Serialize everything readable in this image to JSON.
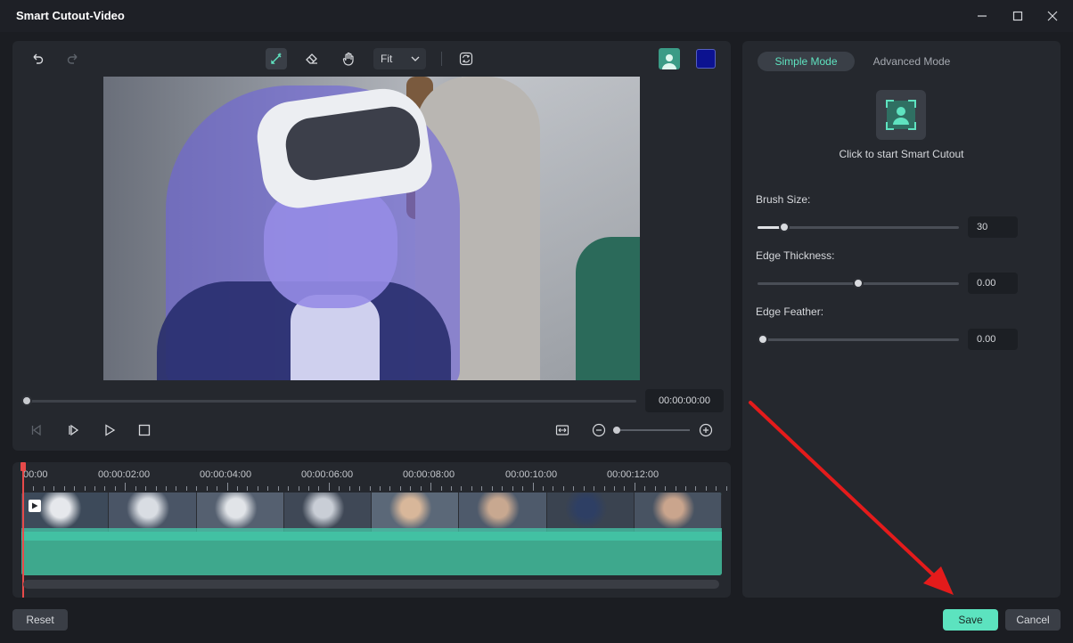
{
  "window": {
    "title": "Smart Cutout-Video"
  },
  "toolbar": {
    "zoom_select_value": "Fit"
  },
  "player": {
    "current_time": "00:00:00:00"
  },
  "timeline": {
    "ticks": [
      "00:00",
      "00:00:02:00",
      "00:00:04:00",
      "00:00:06:00",
      "00:00:08:00",
      "00:00:10:00",
      "00:00:12:00"
    ]
  },
  "right_panel": {
    "tabs": [
      {
        "label": "Simple Mode",
        "active": true
      },
      {
        "label": "Advanced Mode",
        "active": false
      }
    ],
    "cutout_prompt": "Click to start Smart Cutout",
    "brush_size": {
      "label": "Brush Size:",
      "value": "30",
      "fraction": 0.11
    },
    "edge_thickness": {
      "label": "Edge Thickness:",
      "value": "0.00",
      "fraction": 0.5
    },
    "edge_feather": {
      "label": "Edge Feather:",
      "value": "0.00",
      "fraction": 0.0
    }
  },
  "footer": {
    "reset_label": "Reset",
    "save_label": "Save",
    "cancel_label": "Cancel"
  },
  "colors": {
    "accent": "#5ce3bf",
    "mask_color": "#0c1290",
    "annotation_arrow": "#e41b1b"
  },
  "icons": [
    "undo-icon",
    "redo-icon",
    "brush-icon",
    "eraser-icon",
    "hand-icon",
    "refresh-icon",
    "person-icon",
    "minimize-icon",
    "maximize-icon",
    "close-icon"
  ]
}
